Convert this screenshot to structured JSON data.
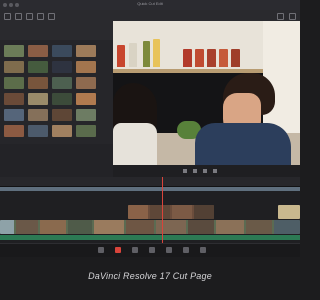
{
  "window": {
    "title": "Quick Cut Edit"
  },
  "caption": "DaVinci Resolve 17 Cut Page",
  "colors": {
    "playhead": "#d9443b",
    "audio": "#2c7a54"
  },
  "media_pool": {
    "thumbnails": [
      {
        "color": "#6b7c58"
      },
      {
        "color": "#8a5d45"
      },
      {
        "color": "#3b4a5c"
      },
      {
        "color": "#9d7b5a"
      },
      {
        "color": "#7f6c4d"
      },
      {
        "color": "#455b3e"
      },
      {
        "color": "#2e3340"
      },
      {
        "color": "#a3754e"
      },
      {
        "color": "#5c6d4a"
      },
      {
        "color": "#78553c"
      },
      {
        "color": "#4d6050"
      },
      {
        "color": "#8e6a4f"
      },
      {
        "color": "#6a4a38"
      },
      {
        "color": "#9a8b6a"
      },
      {
        "color": "#3c4b3a"
      },
      {
        "color": "#b07a4f"
      },
      {
        "color": "#55657a"
      },
      {
        "color": "#85705a"
      },
      {
        "color": "#5e4636"
      },
      {
        "color": "#6d7c63"
      },
      {
        "color": "#8c5a42"
      },
      {
        "color": "#4c5a6b"
      },
      {
        "color": "#a08060"
      },
      {
        "color": "#5a6b4c"
      }
    ]
  },
  "viewer_controls": [
    "prev-icon",
    "play-icon",
    "next-icon",
    "loop-icon"
  ],
  "page_tabs": [
    {
      "name": "media"
    },
    {
      "name": "cut",
      "active": true
    },
    {
      "name": "edit"
    },
    {
      "name": "fusion"
    },
    {
      "name": "color"
    },
    {
      "name": "fairlight"
    },
    {
      "name": "deliver"
    }
  ]
}
